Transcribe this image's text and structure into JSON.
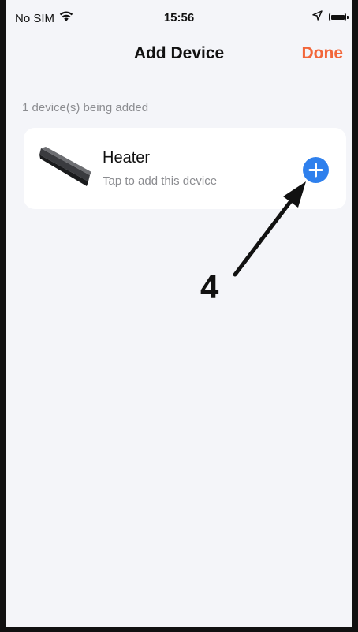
{
  "status_bar": {
    "carrier": "No SIM",
    "time": "15:56"
  },
  "nav": {
    "title": "Add Device",
    "done_label": "Done"
  },
  "section": {
    "label": "1 device(s) being added"
  },
  "device": {
    "name": "Heater",
    "hint": "Tap to add this device"
  },
  "annotation": {
    "number": "4"
  },
  "colors": {
    "accent": "#f2663a",
    "add_button": "#2f80ed",
    "background": "#f4f5f9"
  },
  "icons": {
    "wifi": "wifi-icon",
    "location": "location-arrow-icon",
    "battery": "battery-icon",
    "add": "plus-circle-icon"
  }
}
